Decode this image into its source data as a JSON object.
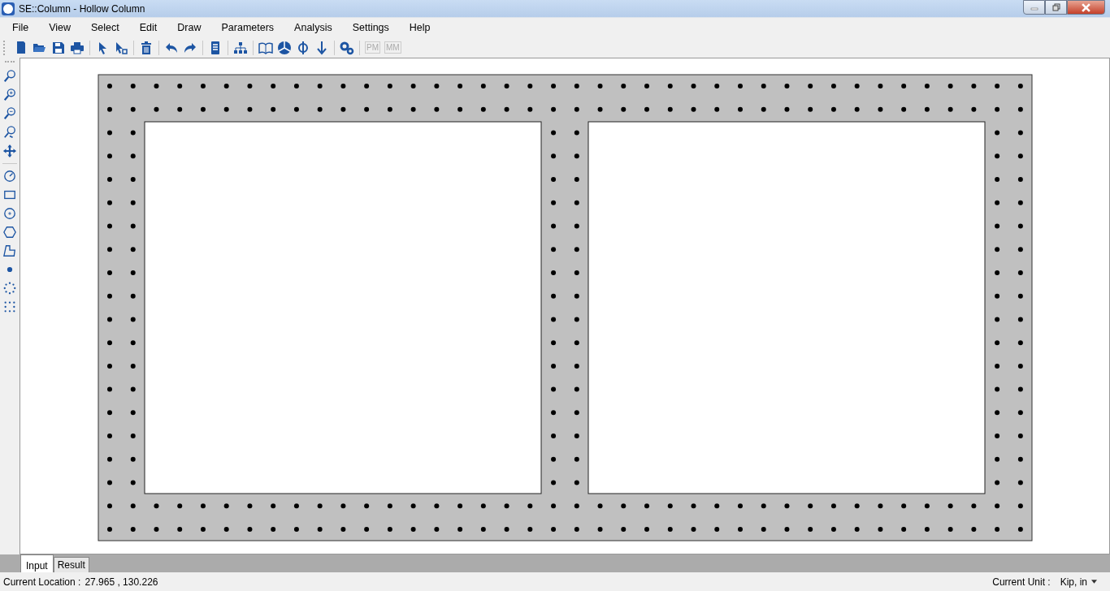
{
  "window": {
    "title": "SE::Column - Hollow Column"
  },
  "menu": [
    "File",
    "View",
    "Select",
    "Edit",
    "Draw",
    "Parameters",
    "Analysis",
    "Settings",
    "Help"
  ],
  "toolbar_text_buttons": [
    {
      "label": "PM",
      "disabled": true
    },
    {
      "label": "MM",
      "disabled": true
    }
  ],
  "tabs": [
    {
      "label": "Input",
      "selected": true
    },
    {
      "label": "Result",
      "selected": false
    }
  ],
  "status_bar": {
    "location_label": "Current Location :",
    "location_value": "27.965 , 130.226",
    "unit_label": "Current Unit :",
    "unit_value": "Kip, in"
  }
}
